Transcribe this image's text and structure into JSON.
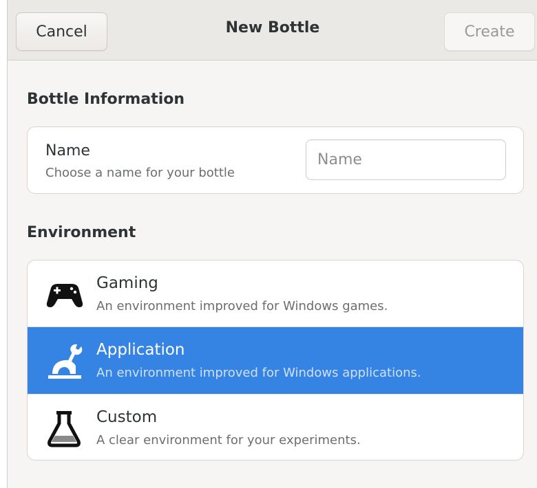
{
  "header": {
    "cancel_label": "Cancel",
    "title": "New Bottle",
    "create_label": "Create"
  },
  "bottle_info": {
    "section_title": "Bottle Information",
    "name_title": "Name",
    "name_subtitle": "Choose a name for your bottle",
    "name_placeholder": "Name",
    "name_value": ""
  },
  "environment": {
    "section_title": "Environment",
    "selected": "Application",
    "options": [
      {
        "title": "Gaming",
        "subtitle": "An environment improved for Windows games.",
        "icon": "gamepad-icon"
      },
      {
        "title": "Application",
        "subtitle": "An environment improved for Windows applications.",
        "icon": "application-wrench-icon"
      },
      {
        "title": "Custom",
        "subtitle": "A clear environment for your experiments.",
        "icon": "flask-icon"
      }
    ]
  },
  "colors": {
    "accent": "#3584e4",
    "window_bg": "#f6f5f4",
    "header_bg": "#ebe9e6"
  }
}
